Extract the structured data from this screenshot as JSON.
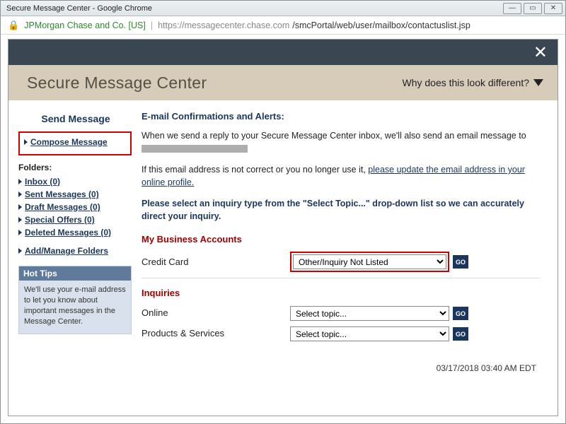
{
  "browser": {
    "title": "Secure Message Center - Google Chrome",
    "ev_org": "JPMorgan Chase and Co. [US]",
    "url_host": "https://messagecenter.chase.com",
    "url_path": "/smcPortal/web/user/mailbox/contactuslist.jsp"
  },
  "header": {
    "title": "Secure Message Center",
    "why_diff": "Why does this look different?"
  },
  "sidebar": {
    "title": "Send Message",
    "compose": "Compose Message",
    "folders_label": "Folders:",
    "folders": [
      "Inbox (0)",
      "Sent Messages (0)",
      "Draft Messages (0)",
      "Special Offers (0)",
      "Deleted Messages (0)"
    ],
    "add_manage": "Add/Manage Folders",
    "hot_tips_title": "Hot Tips",
    "hot_tips_body": "We'll use your e-mail address to let you know about important messages in the Message Center."
  },
  "content": {
    "heading1": "E-mail Confirmations and Alerts:",
    "para1_a": "When we send a reply to your Secure Message Center inbox, we'll also send an email message to ",
    "para2_a": "If this email address is not correct or you no longer use it, ",
    "para2_link": "please update the email address in your online profile.",
    "instruct": "Please select an inquiry type from the \"Select Topic...\" drop-down list so we can accurately direct your inquiry.",
    "section1": "My Business Accounts",
    "section2": "Inquiries",
    "rows": {
      "credit_card": {
        "label": "Credit Card",
        "selected": "Other/Inquiry Not Listed"
      },
      "online": {
        "label": "Online",
        "selected": "Select topic..."
      },
      "products": {
        "label": "Products & Services",
        "selected": "Select topic..."
      }
    },
    "go": "GO",
    "timestamp": "03/17/2018 03:40 AM EDT"
  }
}
